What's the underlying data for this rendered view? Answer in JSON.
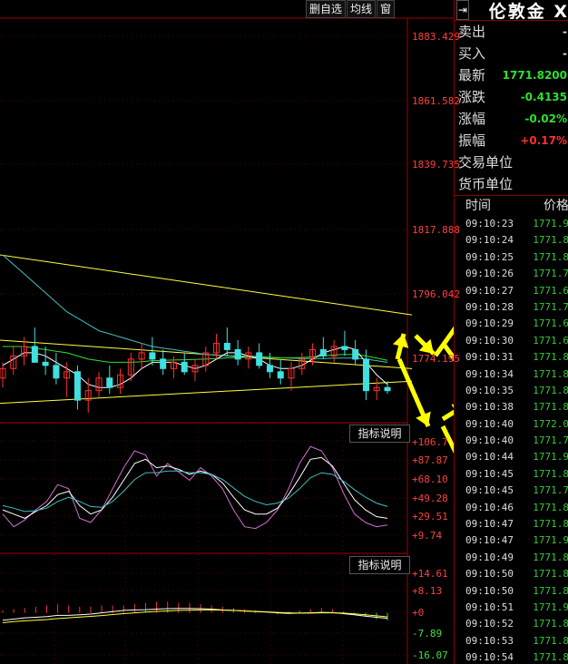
{
  "toolbar": {
    "buttons": [
      "删自选",
      "均线",
      "窗"
    ]
  },
  "colors": {
    "up": "#ff3030",
    "down": "#40e0e0",
    "grid": "#5a0000",
    "axis": "#a00000",
    "yellow": "#ffff40",
    "white": "#ffffff",
    "green": "#2ee02e",
    "pink": "#d070d0",
    "cyan": "#40c0c0",
    "annot": "#ffff00"
  },
  "main_chart": {
    "y_ticks": [
      "1883.429",
      "1861.582",
      "1839.735",
      "1817.888",
      "1796.042",
      "1774.195"
    ],
    "price_range": [
      1763,
      1890
    ],
    "candles": [
      {
        "o": 1776,
        "h": 1781,
        "l": 1773,
        "c": 1779
      },
      {
        "o": 1779,
        "h": 1786,
        "l": 1777,
        "c": 1783
      },
      {
        "o": 1783,
        "h": 1789,
        "l": 1780,
        "c": 1786
      },
      {
        "o": 1786,
        "h": 1792,
        "l": 1783,
        "c": 1781
      },
      {
        "o": 1781,
        "h": 1786,
        "l": 1777,
        "c": 1780
      },
      {
        "o": 1780,
        "h": 1784,
        "l": 1774,
        "c": 1776
      },
      {
        "o": 1776,
        "h": 1781,
        "l": 1770,
        "c": 1778
      },
      {
        "o": 1778,
        "h": 1780,
        "l": 1766,
        "c": 1769
      },
      {
        "o": 1769,
        "h": 1776,
        "l": 1765,
        "c": 1772
      },
      {
        "o": 1772,
        "h": 1778,
        "l": 1770,
        "c": 1776
      },
      {
        "o": 1776,
        "h": 1780,
        "l": 1771,
        "c": 1773
      },
      {
        "o": 1773,
        "h": 1779,
        "l": 1771,
        "c": 1777
      },
      {
        "o": 1777,
        "h": 1784,
        "l": 1775,
        "c": 1782
      },
      {
        "o": 1782,
        "h": 1787,
        "l": 1779,
        "c": 1784
      },
      {
        "o": 1784,
        "h": 1789,
        "l": 1780,
        "c": 1782
      },
      {
        "o": 1782,
        "h": 1785,
        "l": 1777,
        "c": 1779
      },
      {
        "o": 1779,
        "h": 1783,
        "l": 1776,
        "c": 1781
      },
      {
        "o": 1781,
        "h": 1784,
        "l": 1777,
        "c": 1778
      },
      {
        "o": 1778,
        "h": 1782,
        "l": 1775,
        "c": 1780
      },
      {
        "o": 1780,
        "h": 1786,
        "l": 1778,
        "c": 1784
      },
      {
        "o": 1784,
        "h": 1790,
        "l": 1782,
        "c": 1787
      },
      {
        "o": 1787,
        "h": 1792,
        "l": 1783,
        "c": 1785
      },
      {
        "o": 1785,
        "h": 1788,
        "l": 1780,
        "c": 1782
      },
      {
        "o": 1782,
        "h": 1786,
        "l": 1779,
        "c": 1784
      },
      {
        "o": 1784,
        "h": 1787,
        "l": 1779,
        "c": 1780
      },
      {
        "o": 1780,
        "h": 1784,
        "l": 1776,
        "c": 1778
      },
      {
        "o": 1778,
        "h": 1782,
        "l": 1774,
        "c": 1776
      },
      {
        "o": 1776,
        "h": 1781,
        "l": 1772,
        "c": 1779
      },
      {
        "o": 1779,
        "h": 1784,
        "l": 1777,
        "c": 1782
      },
      {
        "o": 1782,
        "h": 1787,
        "l": 1780,
        "c": 1785
      },
      {
        "o": 1785,
        "h": 1789,
        "l": 1782,
        "c": 1783
      },
      {
        "o": 1783,
        "h": 1788,
        "l": 1781,
        "c": 1786
      },
      {
        "o": 1786,
        "h": 1791,
        "l": 1783,
        "c": 1785
      },
      {
        "o": 1785,
        "h": 1788,
        "l": 1780,
        "c": 1782
      },
      {
        "o": 1782,
        "h": 1785,
        "l": 1769,
        "c": 1772
      },
      {
        "o": 1772,
        "h": 1776,
        "l": 1769,
        "c": 1773
      },
      {
        "o": 1773,
        "h": 1775,
        "l": 1771,
        "c": 1772
      }
    ],
    "ma_long": [
      1815,
      1812,
      1809,
      1806,
      1803,
      1800,
      1797,
      1795,
      1793,
      1791,
      1790,
      1789,
      1788,
      1787,
      1786,
      1785.5,
      1785,
      1784.5,
      1784,
      1783.5,
      1783.3,
      1783,
      1783,
      1783,
      1782.8,
      1782.6,
      1782.4,
      1782.3,
      1782.2,
      1782.2,
      1782.2,
      1782.3,
      1782.3,
      1782.3,
      1782,
      1781.5,
      1781
    ],
    "ma_mid": [
      1786,
      1786,
      1786,
      1785.5,
      1785,
      1784.5,
      1784,
      1783,
      1782,
      1781.5,
      1781,
      1781,
      1781,
      1781.2,
      1781.5,
      1781.6,
      1781.7,
      1781.8,
      1781.9,
      1782,
      1782.2,
      1782.4,
      1782.5,
      1782.6,
      1782.6,
      1782.5,
      1782.4,
      1782.4,
      1782.5,
      1782.7,
      1783,
      1783.3,
      1783.5,
      1783.5,
      1783,
      1782.3,
      1781.6
    ],
    "ma_short": [
      1780,
      1782,
      1784,
      1784,
      1783,
      1781,
      1779,
      1777,
      1774,
      1773,
      1773,
      1774,
      1776,
      1779,
      1781,
      1781,
      1781,
      1780,
      1779,
      1780,
      1782,
      1784,
      1784,
      1783,
      1782,
      1780,
      1779,
      1779,
      1780,
      1782,
      1784,
      1785,
      1786,
      1785,
      1781,
      1777,
      1774
    ],
    "trendlines": [
      {
        "from": [
          0,
          1815
        ],
        "to": [
          454,
          1796
        ]
      },
      {
        "from": [
          0,
          1788
        ],
        "to": [
          454,
          1779
        ]
      },
      {
        "from": [
          0,
          1768
        ],
        "to": [
          454,
          1775
        ]
      }
    ]
  },
  "indicator1": {
    "label": "指标说明",
    "y_ticks": [
      "+106.7",
      "+87.87",
      "+68.10",
      "+49.28",
      "+29.51",
      "+9.74"
    ],
    "range": [
      0,
      115
    ],
    "line_pink": [
      25,
      10,
      18,
      30,
      40,
      60,
      55,
      20,
      15,
      30,
      55,
      80,
      100,
      95,
      70,
      85,
      75,
      65,
      80,
      70,
      55,
      30,
      10,
      8,
      15,
      30,
      55,
      85,
      105,
      100,
      80,
      50,
      25,
      15,
      10,
      12
    ],
    "line_white": [
      30,
      25,
      20,
      28,
      35,
      48,
      52,
      35,
      25,
      30,
      45,
      65,
      85,
      90,
      80,
      82,
      78,
      72,
      76,
      72,
      62,
      45,
      30,
      25,
      25,
      32,
      48,
      68,
      90,
      92,
      82,
      62,
      42,
      30,
      22,
      20
    ],
    "line_cyan": [
      35,
      32,
      28,
      29,
      32,
      40,
      45,
      40,
      34,
      33,
      40,
      52,
      66,
      74,
      74,
      76,
      76,
      74,
      74,
      72,
      66,
      56,
      46,
      40,
      36,
      38,
      44,
      55,
      68,
      74,
      72,
      64,
      54,
      45,
      38,
      34
    ]
  },
  "indicator2": {
    "label": "指标说明",
    "y_ticks": [
      "+14.61",
      "+8.13",
      "+0",
      "-7.89",
      "-16.07"
    ],
    "range": [
      -17,
      16
    ],
    "bars": [
      1,
      1.5,
      2,
      2.5,
      3,
      3.5,
      3,
      2.5,
      2.5,
      3,
      3,
      3,
      3.5,
      4,
      4.5,
      4.5,
      4,
      4,
      3.5,
      3,
      2.5,
      2,
      1.5,
      1,
      0,
      -0.5,
      0.5,
      1,
      1.5,
      2,
      1.5,
      0.5,
      -0.5,
      -1.5,
      -2.5,
      -3
    ],
    "line_white": [
      -3,
      -2.5,
      -2,
      -1.8,
      -1.5,
      -1,
      -1,
      -0.8,
      -0.5,
      0,
      0.5,
      1,
      1.2,
      1.3,
      1.5,
      1.7,
      1.8,
      1.8,
      1.7,
      1.5,
      1.2,
      1,
      0.8,
      0.5,
      0.3,
      0,
      -0.2,
      -0.1,
      0,
      0.2,
      0.1,
      -0.3,
      -0.8,
      -1.3,
      -1.8,
      -2.2
    ],
    "line_yellow": [
      -4,
      -3.5,
      -3.2,
      -3,
      -2.7,
      -2.3,
      -2,
      -1.7,
      -1.4,
      -1.1,
      -0.7,
      -0.3,
      0,
      0.3,
      0.6,
      0.8,
      1,
      1.1,
      1.2,
      1.2,
      1.1,
      1,
      0.8,
      0.6,
      0.4,
      0.2,
      0,
      -0.1,
      -0.1,
      0,
      0,
      -0.1,
      -0.4,
      -0.8,
      -1.2,
      -1.6
    ]
  },
  "quote_panel": {
    "pin_icon": "⇥",
    "title": "伦敦金 X",
    "rows": [
      {
        "label": "卖出",
        "value": "-",
        "color": "#dddddd"
      },
      {
        "label": "买入",
        "value": "-",
        "color": "#dddddd"
      },
      {
        "label": "最新",
        "value": "1771.8200",
        "color": "#2ee02e"
      },
      {
        "label": "涨跌",
        "value": "-0.4135",
        "color": "#2ee02e"
      },
      {
        "label": "涨幅",
        "value": "-0.02%",
        "color": "#2ee02e"
      },
      {
        "label": "振幅",
        "value": "+0.17%",
        "color": "#ff3030"
      }
    ],
    "info_rows": [
      "交易单位",
      "货币单位"
    ],
    "ticks_header": {
      "time": "时间",
      "price": "价格"
    },
    "ticks": [
      {
        "time": "09:10:23",
        "price": "1771.9"
      },
      {
        "time": "09:10:24",
        "price": "1771.8"
      },
      {
        "time": "09:10:25",
        "price": "1771.8"
      },
      {
        "time": "09:10:26",
        "price": "1771.7"
      },
      {
        "time": "09:10:27",
        "price": "1771.6"
      },
      {
        "time": "09:10:28",
        "price": "1771.7"
      },
      {
        "time": "09:10:29",
        "price": "1771.6"
      },
      {
        "time": "09:10:30",
        "price": "1771.6"
      },
      {
        "time": "09:10:31",
        "price": "1771.8"
      },
      {
        "time": "09:10:34",
        "price": "1771.8"
      },
      {
        "time": "09:10:35",
        "price": "1771.8"
      },
      {
        "time": "09:10:38",
        "price": "1771.8"
      },
      {
        "time": "09:10:40",
        "price": "1772.0"
      },
      {
        "time": "09:10:40",
        "price": "1771.7"
      },
      {
        "time": "09:10:44",
        "price": "1771.9"
      },
      {
        "time": "09:10:45",
        "price": "1771.8"
      },
      {
        "time": "09:10:45",
        "price": "1771.7"
      },
      {
        "time": "09:10:46",
        "price": "1771.8"
      },
      {
        "time": "09:10:47",
        "price": "1771.8"
      },
      {
        "time": "09:10:47",
        "price": "1771.9"
      },
      {
        "time": "09:10:49",
        "price": "1771.8"
      },
      {
        "time": "09:10:50",
        "price": "1771.8"
      },
      {
        "time": "09:10:50",
        "price": "1771.8"
      },
      {
        "time": "09:10:51",
        "price": "1771.9"
      },
      {
        "time": "09:10:52",
        "price": "1771.8"
      },
      {
        "time": "09:10:53",
        "price": "1771.8"
      },
      {
        "time": "09:10:54",
        "price": "1771.8"
      }
    ]
  }
}
